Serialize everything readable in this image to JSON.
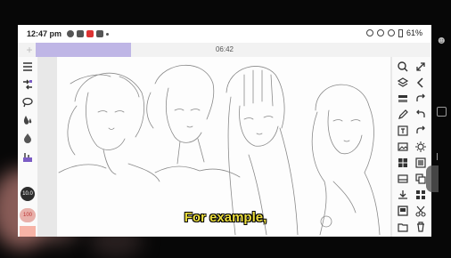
{
  "status_bar": {
    "time": "12:47 pm",
    "battery": "61%"
  },
  "top_bar": {
    "add_label": "+",
    "timer": "06:42",
    "progress_fraction": 0.24
  },
  "left_toolbar": {
    "tools": [
      "menu-icon",
      "transform-icon",
      "lasso-icon",
      "fill-icon",
      "blur-icon",
      "filter-icon"
    ],
    "brush_size": "10.0",
    "brush_opacity": "100"
  },
  "right_toolbar": {
    "tools": [
      "search-icon",
      "expand-icon",
      "layers-icon",
      "back-icon",
      "layer-stack-icon",
      "redo-icon",
      "pen-icon",
      "undo-icon",
      "text-icon",
      "redo-arrow-icon",
      "image-icon",
      "magic-icon",
      "grid-icon",
      "frame-icon",
      "crop-icon",
      "copy-icon",
      "import-icon",
      "grid-view-icon",
      "square-icon",
      "cut-icon",
      "folder-icon",
      "delete-icon"
    ]
  },
  "colors": {
    "accent": "#bfb6e6",
    "swatch": "#f6b3a6",
    "caption": "#ecde3e"
  },
  "caption": "For example,"
}
